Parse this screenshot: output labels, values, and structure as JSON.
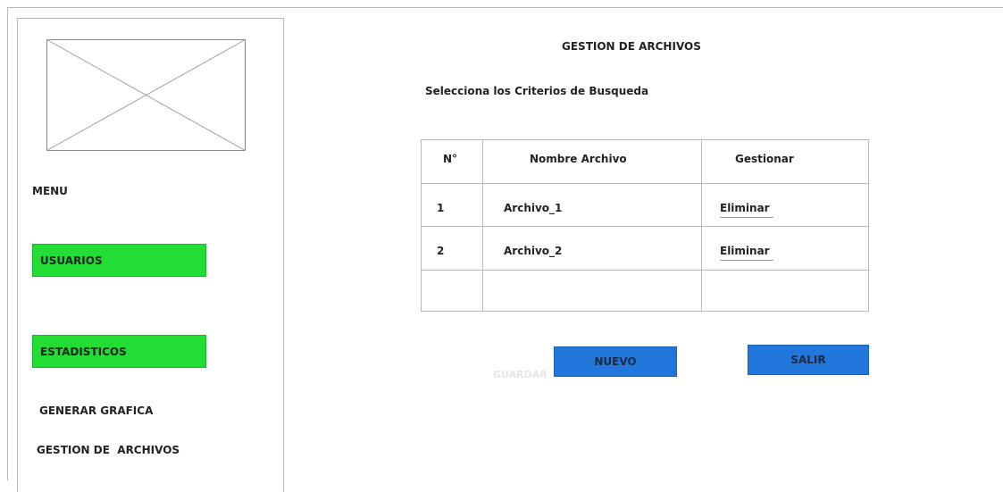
{
  "sidebar": {
    "logo_icon": "image-placeholder-icon",
    "menu_title": "MENU",
    "items": [
      {
        "label": "USUARIOS",
        "color": "#22dd33"
      },
      {
        "label": "ESTADISTICOS",
        "color": "#22dd33"
      },
      {
        "label": "GENERAR GRAFICA"
      },
      {
        "label": "GESTION DE  ARCHIVOS"
      }
    ]
  },
  "main": {
    "title": "GESTION DE ARCHIVOS",
    "subtitle": "Selecciona los Criterios de Busqueda",
    "table": {
      "columns": [
        "N°",
        "Nombre Archivo",
        "Gestionar"
      ],
      "rows": [
        {
          "num": "1",
          "name": "Archivo_1",
          "action": "Eliminar"
        },
        {
          "num": "2",
          "name": "Archivo_2",
          "action": "Eliminar"
        },
        {
          "num": "",
          "name": "",
          "action": ""
        }
      ]
    },
    "ghost_label": "GUARDAR",
    "buttons": {
      "nuevo": "NUEVO",
      "salir": "SALIR",
      "color": "#2277dd"
    }
  }
}
